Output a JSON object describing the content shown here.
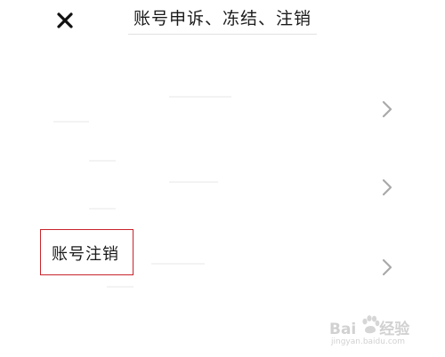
{
  "header": {
    "title": "账号申诉、冻结、注销",
    "close_icon": "close-icon"
  },
  "rows": [
    {
      "label": "",
      "icon": "chevron-right-icon"
    },
    {
      "label": "",
      "icon": "chevron-right-icon"
    },
    {
      "label": "账号注销",
      "icon": "chevron-right-icon"
    }
  ],
  "highlight": {
    "color": "#c8242b"
  },
  "watermark": {
    "logo_left": "Bai",
    "logo_right": "经验",
    "url": "jingyan.baidu.com"
  }
}
